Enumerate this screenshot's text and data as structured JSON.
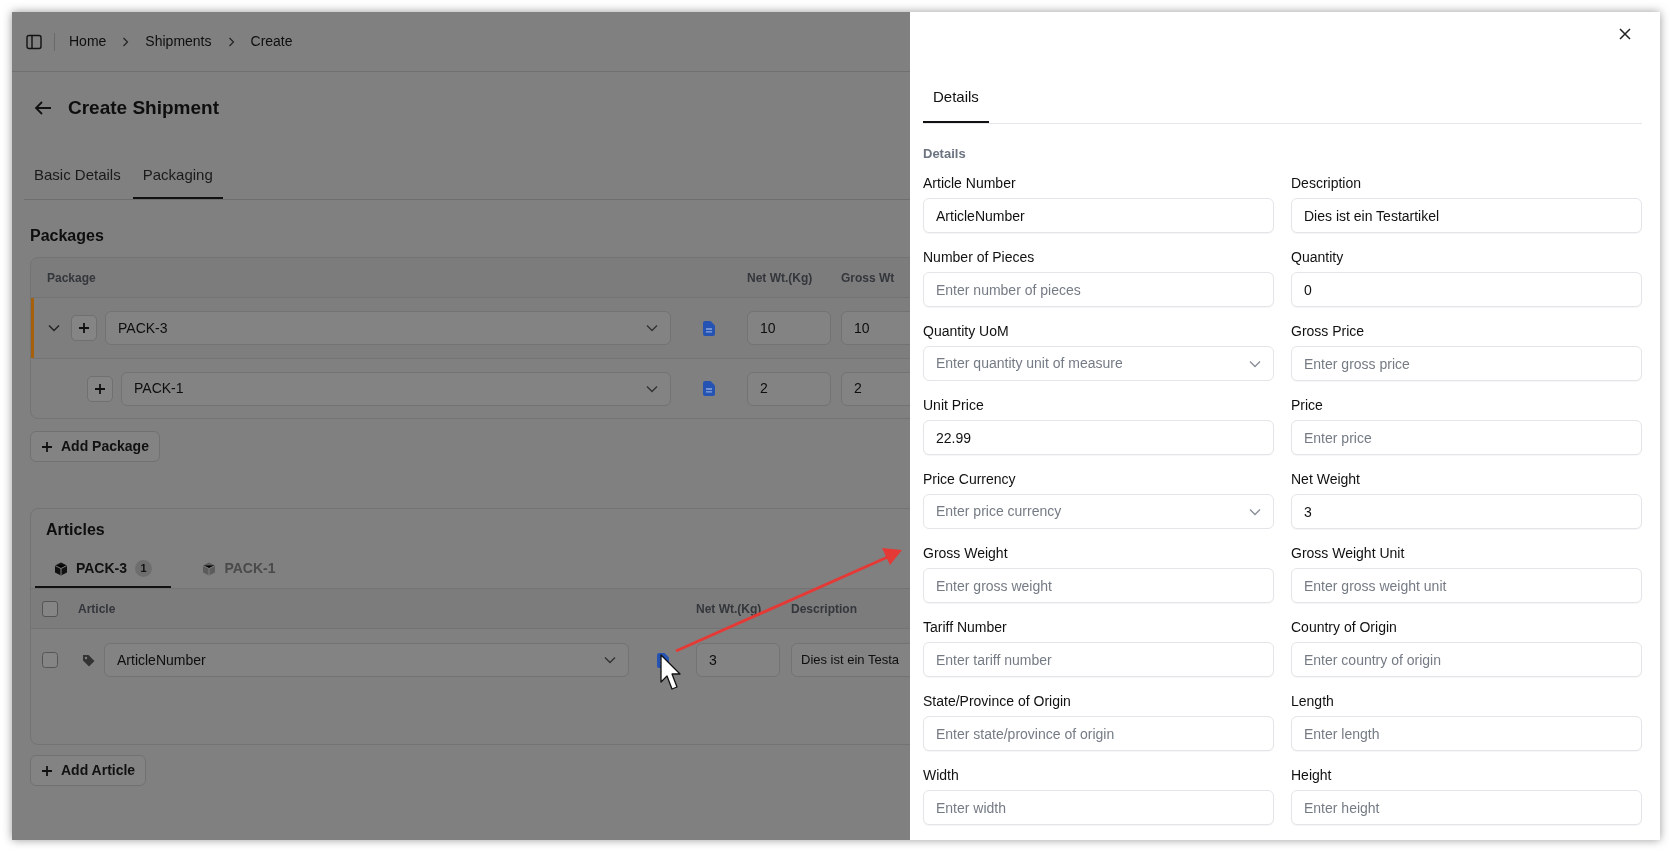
{
  "breadcrumb": [
    "Home",
    "Shipments",
    "Create"
  ],
  "page_title": "Create Shipment",
  "tabs": [
    {
      "label": "Basic Details",
      "selected": false
    },
    {
      "label": "Packaging",
      "selected": true
    }
  ],
  "packages": {
    "title": "Packages",
    "columns": [
      "Package",
      "Net Wt.(Kg)",
      "Gross Wt"
    ],
    "rows": [
      {
        "package": "PACK-3",
        "net_weight": "10",
        "gross_weight": "10",
        "selected": true,
        "expanded": true,
        "children": [
          {
            "package": "PACK-1",
            "net_weight": "2",
            "gross_weight": "2",
            "selected": false
          }
        ]
      }
    ]
  },
  "add_package_button": "Add Package",
  "articles": {
    "title": "Articles",
    "header_checked": false,
    "tabs": [
      {
        "label": "PACK-3",
        "count": "1",
        "selected": true
      },
      {
        "label": "PACK-1",
        "selected": false
      }
    ],
    "columns": [
      "Article",
      "Net Wt.(Kg)",
      "Description"
    ],
    "rows": [
      {
        "article": "ArticleNumber",
        "net_weight": "3",
        "description": "Dies ist ein Testa",
        "checked": false
      }
    ]
  },
  "add_article_button": "Add Article",
  "drawer": {
    "tabs": [
      {
        "label": "Details",
        "selected": true
      }
    ],
    "section": "Details",
    "fields": [
      {
        "label": "Article Number",
        "kind": "text",
        "value": "ArticleNumber"
      },
      {
        "label": "Description",
        "kind": "text",
        "value": "Dies ist ein Testartikel"
      },
      {
        "label": "Number of Pieces",
        "kind": "text",
        "placeholder": "Enter number of pieces"
      },
      {
        "label": "Quantity",
        "kind": "text",
        "value": "0"
      },
      {
        "label": "Quantity UoM",
        "kind": "select",
        "placeholder": "Enter quantity unit of measure"
      },
      {
        "label": "Gross Price",
        "kind": "text",
        "placeholder": "Enter gross price"
      },
      {
        "label": "Unit Price",
        "kind": "text",
        "value": "22.99"
      },
      {
        "label": "Price",
        "kind": "text",
        "placeholder": "Enter price"
      },
      {
        "label": "Price Currency",
        "kind": "select",
        "placeholder": "Enter price currency"
      },
      {
        "label": "Net Weight",
        "kind": "text",
        "value": "3"
      },
      {
        "label": "Gross Weight",
        "kind": "text",
        "placeholder": "Enter gross weight"
      },
      {
        "label": "Gross Weight Unit",
        "kind": "text",
        "placeholder": "Enter gross weight unit"
      },
      {
        "label": "Tariff Number",
        "kind": "text",
        "placeholder": "Enter tariff number"
      },
      {
        "label": "Country of Origin",
        "kind": "text",
        "placeholder": "Enter country of origin"
      },
      {
        "label": "State/Province of Origin",
        "kind": "text",
        "placeholder": "Enter state/province of origin"
      },
      {
        "label": "Length",
        "kind": "text",
        "placeholder": "Enter length"
      },
      {
        "label": "Width",
        "kind": "text",
        "placeholder": "Enter width"
      },
      {
        "label": "Height",
        "kind": "text",
        "placeholder": "Enter height"
      }
    ]
  }
}
